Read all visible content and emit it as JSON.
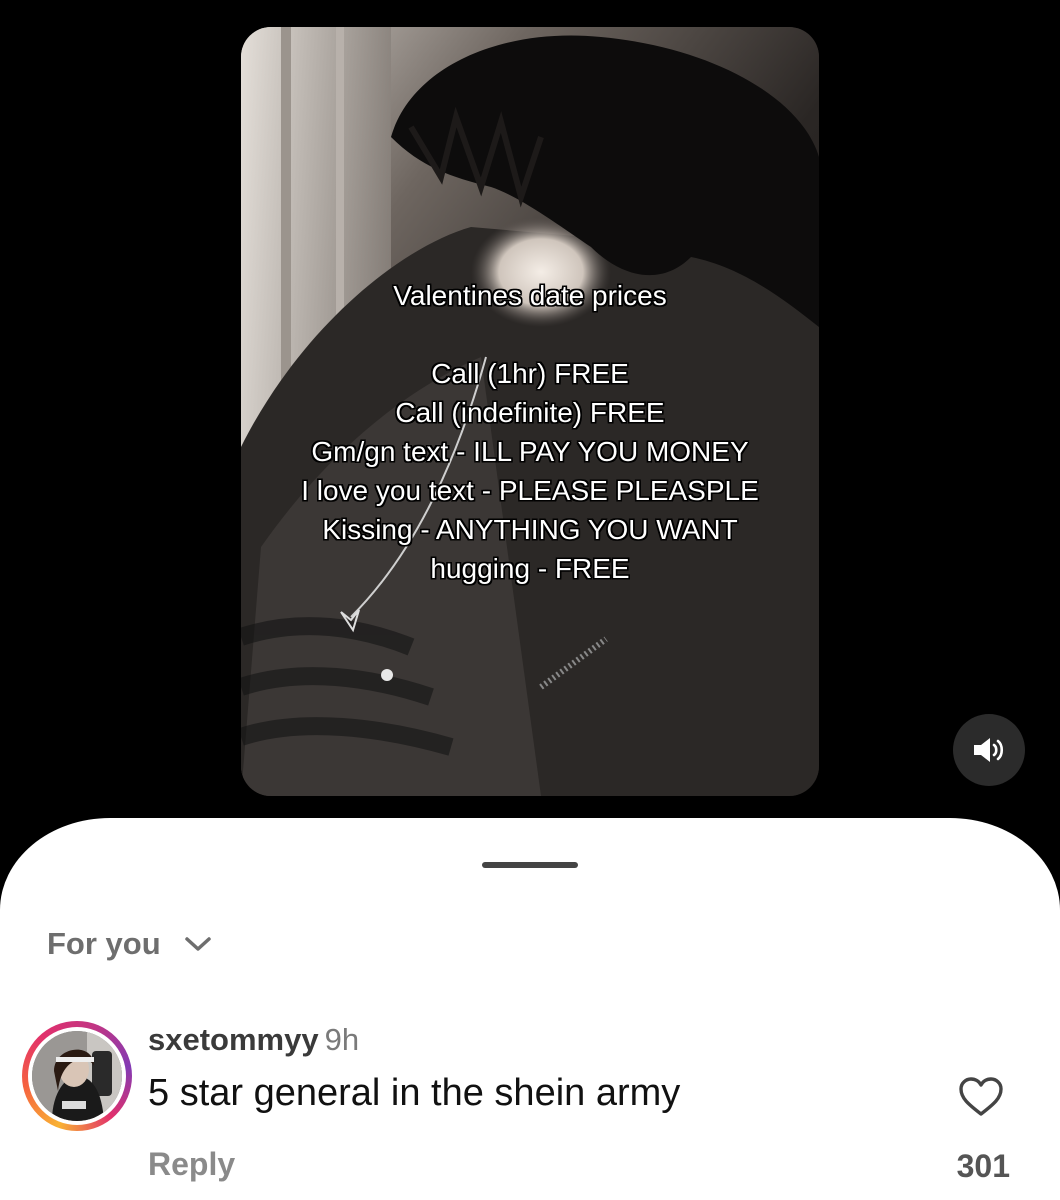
{
  "video": {
    "overlay_lines": [
      "Valentines date prices",
      "",
      "Call (1hr) FREE",
      "Call (indefinite) FREE",
      "Gm/gn text - ILL PAY YOU MONEY",
      "I love you text - PLEASE PLEASPLE",
      "Kissing - ANYTHING YOU WANT",
      "hugging - FREE"
    ],
    "sound_icon": "speaker-on-icon"
  },
  "comments_sheet": {
    "filter_label": "For you",
    "filter_icon": "chevron-down-icon",
    "comment": {
      "username": "sxetommyy",
      "time": "9h",
      "text": "5 star general in the shein army",
      "reply_label": "Reply",
      "like_count": "301",
      "like_icon": "heart-outline-icon"
    }
  },
  "colors": {
    "background": "#000000",
    "sheet": "#ffffff",
    "avatar_ring_start": "#f9b233",
    "avatar_ring_end": "#c13584"
  }
}
